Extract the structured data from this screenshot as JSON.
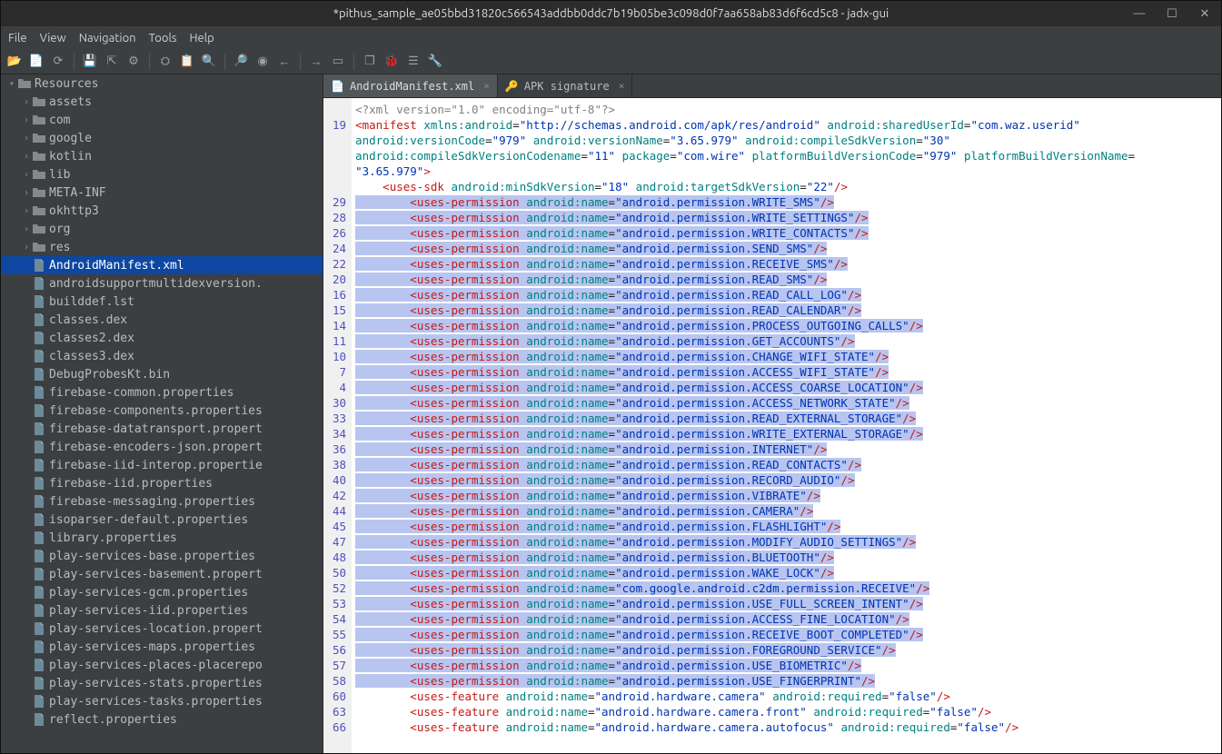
{
  "window": {
    "title": "*pithus_sample_ae05bbd31820c566543addbb0ddc7b19b05be3c098d0f7aa658ab83d6f6cd5c8 - jadx-gui"
  },
  "menu": [
    "File",
    "View",
    "Navigation",
    "Tools",
    "Help"
  ],
  "toolbar_icons": [
    "folder-open-icon",
    "add-file-icon",
    "save-icon",
    "sync-icon",
    "export-icon",
    "settings-icon",
    "gradle-icon",
    "log-icon",
    "search-icon",
    "find-icon",
    "deobf-icon",
    "back-icon",
    "forward-icon",
    "debug-window-icon",
    "new-window-icon",
    "bug-icon",
    "list-icon",
    "wrench-icon"
  ],
  "sidebar": {
    "root_label": "Resources",
    "folders": [
      "assets",
      "com",
      "google",
      "kotlin",
      "lib",
      "META-INF",
      "okhttp3",
      "org",
      "res"
    ],
    "selected_file": "AndroidManifest.xml",
    "files": [
      "androidsupportmultidexversion.",
      "builddef.lst",
      "classes.dex",
      "classes2.dex",
      "classes3.dex",
      "DebugProbesKt.bin",
      "firebase-common.properties",
      "firebase-components.properties",
      "firebase-datatransport.propert",
      "firebase-encoders-json.propert",
      "firebase-iid-interop.propertie",
      "firebase-iid.properties",
      "firebase-messaging.properties",
      "isoparser-default.properties",
      "library.properties",
      "play-services-base.properties",
      "play-services-basement.propert",
      "play-services-gcm.properties",
      "play-services-iid.properties",
      "play-services-location.propert",
      "play-services-maps.properties",
      "play-services-places-placerepo",
      "play-services-stats.properties",
      "play-services-tasks.properties",
      "reflect.properties"
    ]
  },
  "tabs": [
    {
      "label": "AndroidManifest.xml",
      "active": true
    },
    {
      "label": "APK signature",
      "active": false
    }
  ],
  "code": {
    "xml_decl": "<?xml version=\"1.0\" encoding=\"utf-8\"?>",
    "manifest": {
      "xmlns": "http://schemas.android.com/apk/res/android",
      "sharedUserId": "com.waz.userid",
      "versionCode": "979",
      "versionName": "3.65.979",
      "compileSdkVersion": "30",
      "compileSdkVersionCodename": "11",
      "package": "com.wire",
      "platformBuildVersionCode": "979",
      "platformBuildVersionName": "3.65.979"
    },
    "uses_sdk": {
      "min": "18",
      "target": "22"
    },
    "gutter_before_perms": [
      "",
      "19",
      "",
      "",
      "",
      "",
      "29"
    ],
    "permissions": [
      {
        "num": "28",
        "name": "android.permission.WRITE_SETTINGS"
      },
      {
        "num": "26",
        "name": "android.permission.WRITE_CONTACTS"
      },
      {
        "num": "24",
        "name": "android.permission.SEND_SMS"
      },
      {
        "num": "22",
        "name": "android.permission.RECEIVE_SMS"
      },
      {
        "num": "20",
        "name": "android.permission.READ_SMS"
      },
      {
        "num": "16",
        "name": "android.permission.READ_CALL_LOG"
      },
      {
        "num": "15",
        "name": "android.permission.READ_CALENDAR"
      },
      {
        "num": "14",
        "name": "android.permission.PROCESS_OUTGOING_CALLS"
      },
      {
        "num": "11",
        "name": "android.permission.GET_ACCOUNTS"
      },
      {
        "num": "10",
        "name": "android.permission.CHANGE_WIFI_STATE"
      },
      {
        "num": "7",
        "name": "android.permission.ACCESS_WIFI_STATE"
      },
      {
        "num": "4",
        "name": "android.permission.ACCESS_COARSE_LOCATION"
      },
      {
        "num": "30",
        "name": "android.permission.ACCESS_NETWORK_STATE"
      },
      {
        "num": "33",
        "name": "android.permission.READ_EXTERNAL_STORAGE"
      },
      {
        "num": "34",
        "name": "android.permission.WRITE_EXTERNAL_STORAGE"
      },
      {
        "num": "36",
        "name": "android.permission.INTERNET"
      },
      {
        "num": "38",
        "name": "android.permission.READ_CONTACTS"
      },
      {
        "num": "40",
        "name": "android.permission.RECORD_AUDIO"
      },
      {
        "num": "42",
        "name": "android.permission.VIBRATE"
      },
      {
        "num": "44",
        "name": "android.permission.CAMERA"
      },
      {
        "num": "45",
        "name": "android.permission.FLASHLIGHT"
      },
      {
        "num": "47",
        "name": "android.permission.MODIFY_AUDIO_SETTINGS"
      },
      {
        "num": "48",
        "name": "android.permission.BLUETOOTH"
      },
      {
        "num": "50",
        "name": "android.permission.WAKE_LOCK"
      },
      {
        "num": "52",
        "name": "com.google.android.c2dm.permission.RECEIVE"
      },
      {
        "num": "53",
        "name": "android.permission.USE_FULL_SCREEN_INTENT"
      },
      {
        "num": "54",
        "name": "android.permission.ACCESS_FINE_LOCATION"
      },
      {
        "num": "55",
        "name": "android.permission.RECEIVE_BOOT_COMPLETED"
      },
      {
        "num": "56",
        "name": "android.permission.FOREGROUND_SERVICE"
      },
      {
        "num": "57",
        "name": "android.permission.USE_BIOMETRIC"
      },
      {
        "num": "58",
        "name": "android.permission.USE_FINGERPRINT"
      }
    ],
    "first_permission": {
      "num": "29",
      "name": "android.permission.WRITE_SMS"
    },
    "features": [
      {
        "num": "60",
        "name": "android.hardware.camera",
        "required": "false"
      },
      {
        "num": "63",
        "name": "android.hardware.camera.front",
        "required": "false"
      },
      {
        "num": "66",
        "name": "android.hardware.camera.autofocus",
        "required": "false"
      }
    ]
  }
}
